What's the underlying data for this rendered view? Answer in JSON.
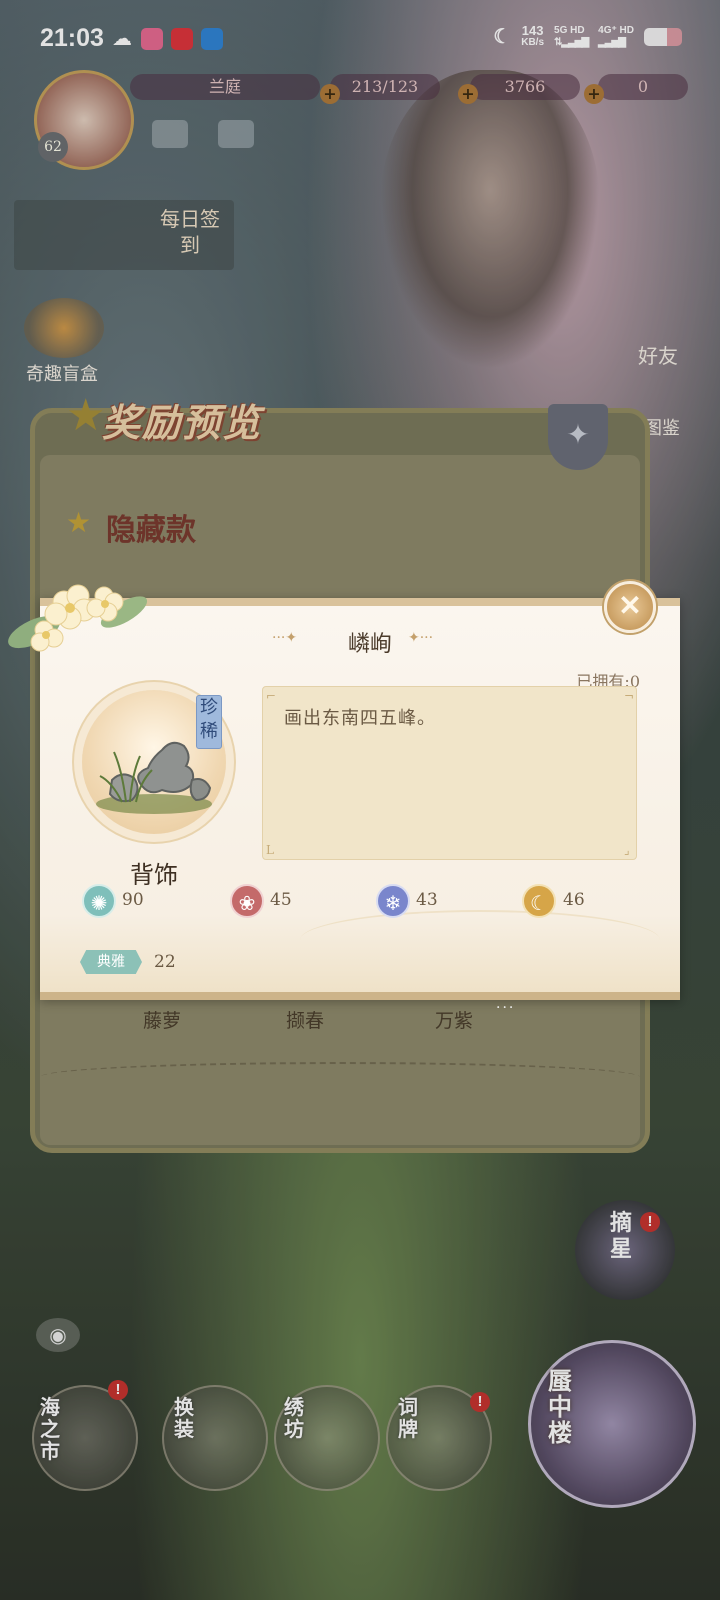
{
  "status_bar": {
    "time": "21:03",
    "net_speed": "143",
    "net_unit": "KB/s",
    "sim1": "5G HD",
    "sim2": "4G⁺ HD"
  },
  "hud": {
    "player_name": "兰庭",
    "stamina": "213/123",
    "currency1": "3766",
    "currency2": "0",
    "level": "62",
    "checkin_label": "每日签到",
    "mystery_box_label": "奇趣盲盒",
    "friends_label": "好友",
    "album_label": "图鉴"
  },
  "reward_preview": {
    "title": "奖励预览",
    "hidden_label": "隐藏款",
    "items": [
      "藤萝",
      "撷春",
      "万紫"
    ]
  },
  "dialog": {
    "item_title": "嶙峋",
    "owned": "已拥有:0",
    "rarity": "珍稀",
    "item_type": "背饰",
    "description": "画出东南四五峰。",
    "stats": [
      {
        "icon": "wind-icon",
        "color": "#7fbfba",
        "value": "90"
      },
      {
        "icon": "lotus-icon",
        "color": "#c46a6a",
        "value": "45"
      },
      {
        "icon": "snowflake-icon",
        "color": "#7a86cc",
        "value": "43"
      },
      {
        "icon": "moon-icon",
        "color": "#d6a548",
        "value": "46"
      }
    ],
    "style_tag": "典雅",
    "style_value": "22"
  },
  "bottom_nav": {
    "sea_market": "海之市",
    "dress_up": "换装",
    "embroidery": "绣坊",
    "word_cards": "词牌",
    "mirage_tower": "蜃中楼",
    "pick_stars": "摘星"
  }
}
